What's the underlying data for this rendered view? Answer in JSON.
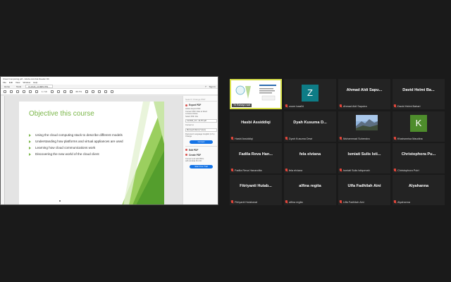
{
  "share": {
    "window_title": "Cloud Computing.pdf - Adobe Acrobat Reader DC",
    "menu": [
      "File",
      "Edit",
      "View",
      "Window",
      "Help"
    ],
    "tabs": [
      "Home",
      "Tools",
      "CLOUD_COMPUTIN..."
    ],
    "tab_right": [
      "?",
      "Sign In"
    ],
    "page_indicator": "1 / 10",
    "zoom": "66.7%",
    "slide": {
      "title": "Objective this course",
      "bullets": [
        "Using the cloud computing stack to describe different models",
        "Understanding how platforms and virtual appliances are used",
        "Learning how cloud communications work",
        "Discovering the new world of the cloud client"
      ]
    },
    "panel": {
      "search": "Search 'Change PDF'",
      "export_title": "Export PDF",
      "export_sub": "Adobe Export PDF",
      "export_lines": [
        "Convert PDF Files to Word",
        "or Excel Online"
      ],
      "select_file": "Select PDF File",
      "file_name": "CLOUD_CO...ALITY.pdf",
      "convert_to": "Convert to",
      "format": "Microsoft Word (*.docx)",
      "lang": "Document Language: English (U.S.) Change",
      "convert_button": "Convert",
      "edit_title": "Edit PDF",
      "create_title": "Create PDF",
      "create_lines": [
        "Convert and edit PDFs",
        "with Acrobat Pro DC"
      ],
      "trial_button": "Start Free Trial"
    }
  },
  "participants": [
    {
      "name": "",
      "label": "Tri Rahayu wat",
      "active": true
    },
    {
      "name": "",
      "label": "zoom baa04",
      "avatar_letter": "Z",
      "avatar_color": "#0e7c86"
    },
    {
      "name": "Ahmad Aldi Sapu...",
      "label": "Ahmad Aldi Saputra"
    },
    {
      "name": "David Helmi Ba...",
      "label": "David Helmi Bahari"
    },
    {
      "name": "Hasbi Assiddiqi",
      "label": "Hasbi Assiddiqi"
    },
    {
      "name": "Dyah Kusuma D...",
      "label": "Dyah Kusuma Dewi"
    },
    {
      "name": "",
      "label": "Muhammad Suhendra",
      "photo": true
    },
    {
      "name": "",
      "label": "Khairunnisa Maudina",
      "avatar_letter": "K",
      "avatar_color": "#4e8d2c"
    },
    {
      "name": "Fadila Reva Han...",
      "label": "Fadila Reva Hanandita"
    },
    {
      "name": "fela elviana",
      "label": "fela elviana"
    },
    {
      "name": "Ismiati Sulis Isti...",
      "label": "Ismiati Sulis Istiqomah"
    },
    {
      "name": "Christophora Pu...",
      "label": "Christophora Putri"
    },
    {
      "name": "Fitriyanti Hutab...",
      "label": "Fitriyanti Hutabarat"
    },
    {
      "name": "alfina regita",
      "label": "alfina regita"
    },
    {
      "name": "Ulfa Fadhilah Aini",
      "label": "Ulfa Fadhilah Aini"
    },
    {
      "name": "Alyahanna",
      "label": "Alyahanna"
    }
  ]
}
